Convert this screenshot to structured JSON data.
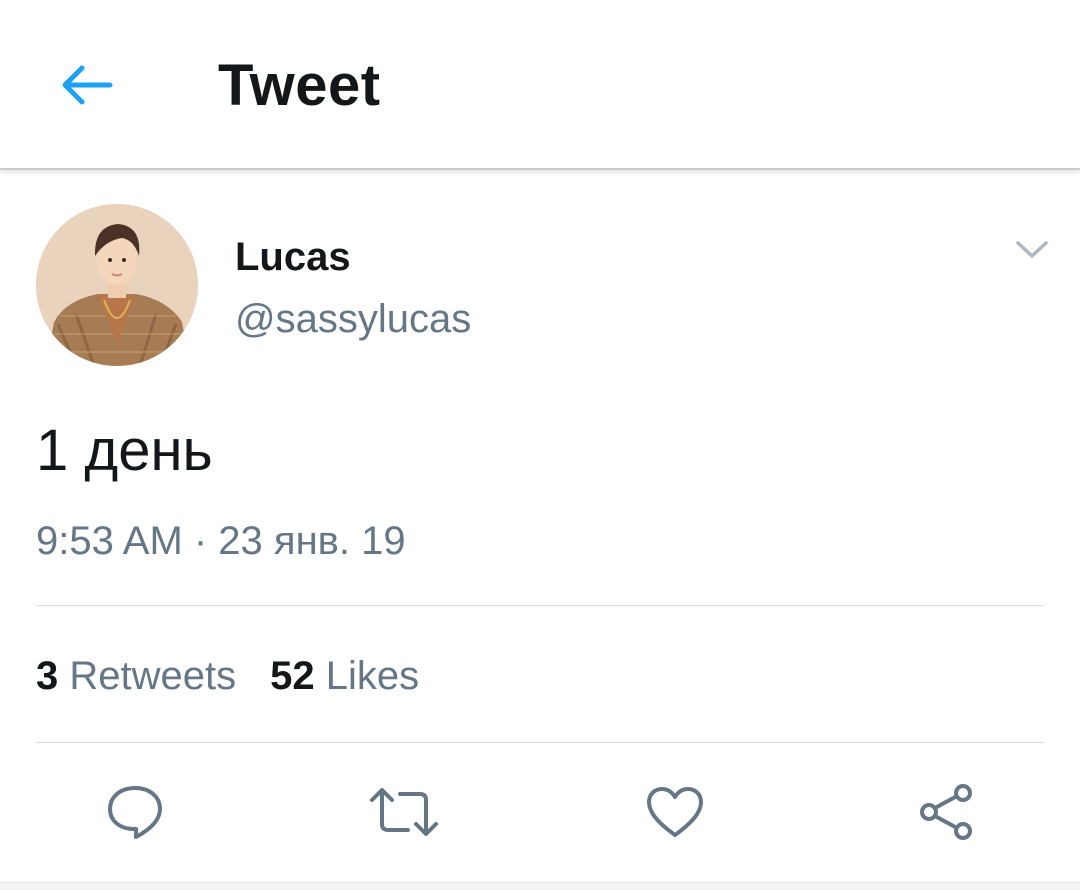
{
  "header": {
    "title": "Tweet",
    "back_icon": "arrow-left-icon",
    "accent_color": "#1da1f2"
  },
  "tweet": {
    "author_name": "Lucas",
    "author_handle": "@sassylucas",
    "text": "1 день",
    "timestamp": "9:53 AM · 23 янв. 19",
    "menu_icon": "chevron-down-icon"
  },
  "stats": {
    "retweets_count": "3",
    "retweets_label": "Retweets",
    "likes_count": "52",
    "likes_label": "Likes"
  },
  "actions": [
    {
      "name": "reply",
      "icon": "reply-icon"
    },
    {
      "name": "retweet",
      "icon": "retweet-icon"
    },
    {
      "name": "like",
      "icon": "heart-icon"
    },
    {
      "name": "share",
      "icon": "share-icon"
    }
  ],
  "colors": {
    "text_primary": "#14171a",
    "text_secondary": "#657786",
    "icon_gray": "#657786"
  }
}
